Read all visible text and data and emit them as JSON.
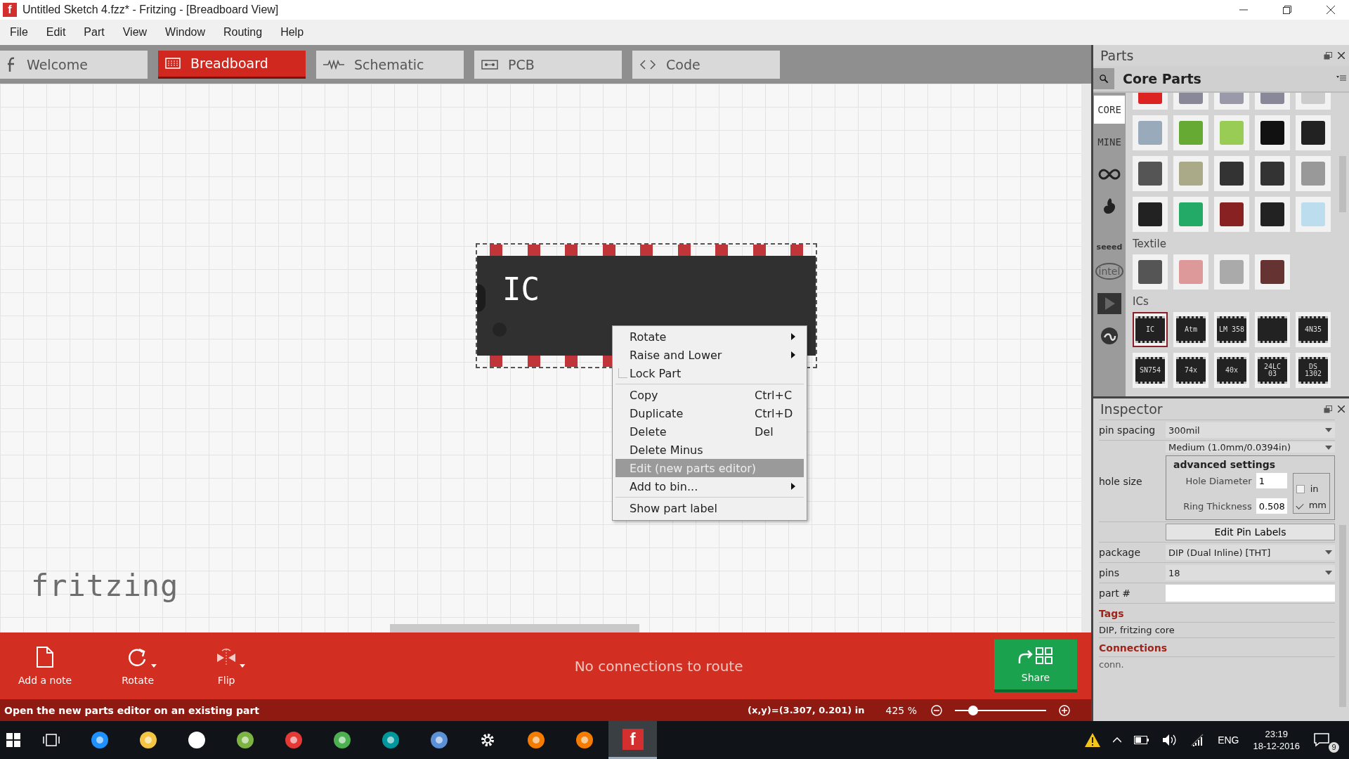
{
  "window": {
    "app_glyph": "f",
    "title": "Untitled Sketch 4.fzz* - Fritzing - [Breadboard View]"
  },
  "menu": [
    "File",
    "Edit",
    "Part",
    "View",
    "Window",
    "Routing",
    "Help"
  ],
  "tabs": [
    {
      "kind": "welcome",
      "label": "Welcome",
      "selected": false
    },
    {
      "kind": "breadboard",
      "label": "Breadboard",
      "selected": true
    },
    {
      "kind": "schematic",
      "label": "Schematic",
      "selected": false
    },
    {
      "kind": "pcb",
      "label": "PCB",
      "selected": false
    },
    {
      "kind": "code",
      "label": "Code",
      "selected": false
    }
  ],
  "canvas": {
    "part_label": "IC",
    "logo": "fritzing"
  },
  "context_menu": [
    {
      "kind": "submenu",
      "label": "Rotate",
      "selected": false
    },
    {
      "kind": "submenu",
      "label": "Raise and Lower",
      "selected": false
    },
    {
      "kind": "check",
      "label": "Lock Part",
      "checked": false,
      "selected": false
    },
    {
      "kind": "separator"
    },
    {
      "kind": "action",
      "label": "Copy",
      "shortcut": "Ctrl+C",
      "selected": false
    },
    {
      "kind": "action",
      "label": "Duplicate",
      "shortcut": "Ctrl+D",
      "selected": false
    },
    {
      "kind": "action",
      "label": "Delete",
      "shortcut": "Del",
      "selected": false
    },
    {
      "kind": "action",
      "label": "Delete Minus",
      "selected": false
    },
    {
      "kind": "action",
      "label": "Edit (new parts editor)",
      "selected": true
    },
    {
      "kind": "submenu",
      "label": "Add to bin...",
      "selected": false
    },
    {
      "kind": "separator"
    },
    {
      "kind": "action",
      "label": "Show part label",
      "selected": false
    }
  ],
  "toolbar": {
    "tools": [
      {
        "kind": "note",
        "label": "Add a note",
        "caret": false
      },
      {
        "kind": "rotate",
        "label": "Rotate",
        "caret": true
      },
      {
        "kind": "flip",
        "label": "Flip",
        "caret": true
      }
    ],
    "routing_status": "No connections to route",
    "share": "Share"
  },
  "status_bar": {
    "message": "Open the new parts editor on an existing part",
    "coordinates": "(x,y)=(3.307, 0.201) in",
    "zoom": "425 %",
    "zoom_slider": {
      "level": 0.2
    }
  },
  "parts": {
    "title": "Parts",
    "bin_title": "Core Parts",
    "bins": [
      {
        "kind": "text",
        "label": "CORE",
        "selected": true
      },
      {
        "kind": "text",
        "label": "MINE",
        "selected": false
      },
      {
        "kind": "infinity",
        "selected": false
      },
      {
        "kind": "flame",
        "selected": false
      },
      {
        "kind": "seeed",
        "label": "seeed",
        "selected": false
      },
      {
        "kind": "intel",
        "label": "intel",
        "selected": false
      },
      {
        "kind": "play",
        "selected": false
      },
      {
        "kind": "swirl",
        "selected": false
      }
    ],
    "sections": [
      {
        "tiles": [
          {
            "kind": "led",
            "selected": false
          },
          {
            "kind": "sensor",
            "selected": false
          },
          {
            "kind": "button",
            "selected": false
          },
          {
            "kind": "sensor",
            "selected": false
          },
          {
            "kind": "switch",
            "selected": false
          },
          {
            "kind": "matrix",
            "selected": false
          },
          {
            "kind": "lcd",
            "selected": false
          },
          {
            "kind": "display",
            "selected": false
          },
          {
            "kind": "buzzer",
            "selected": false
          },
          {
            "kind": "speaker",
            "selected": false
          },
          {
            "kind": "piezo",
            "selected": false
          },
          {
            "kind": "motor",
            "selected": false
          },
          {
            "kind": "driver",
            "selected": false
          },
          {
            "kind": "servo",
            "selected": false
          },
          {
            "kind": "stepper",
            "selected": false
          },
          {
            "kind": "battery",
            "selected": false
          },
          {
            "kind": "board",
            "selected": false
          },
          {
            "kind": "module",
            "selected": false
          },
          {
            "kind": "relay",
            "selected": false
          },
          {
            "kind": "lamp",
            "selected": false
          }
        ]
      },
      {
        "title": "Textile",
        "tiles": [
          {
            "kind": "fabric",
            "selected": false
          },
          {
            "kind": "thread",
            "selected": false
          },
          {
            "kind": "patch",
            "selected": false
          },
          {
            "kind": "wire",
            "selected": false
          }
        ]
      },
      {
        "title": "ICs",
        "tiles": [
          {
            "kind": "ic",
            "label": "IC",
            "selected": true
          },
          {
            "kind": "ic",
            "label": "Atm",
            "selected": false
          },
          {
            "kind": "ic",
            "label": "LM 358",
            "selected": false
          },
          {
            "kind": "ic",
            "selected": false
          },
          {
            "kind": "ic",
            "label": "4N35",
            "selected": false
          },
          {
            "kind": "ic",
            "label": "SN754",
            "selected": false
          },
          {
            "kind": "ic",
            "label": "74x",
            "selected": false
          },
          {
            "kind": "ic",
            "label": "40x",
            "selected": false
          },
          {
            "kind": "ic",
            "label": "24LC 03",
            "selected": false
          },
          {
            "kind": "ic",
            "label": "DS 1302",
            "selected": false
          }
        ]
      }
    ]
  },
  "inspector": {
    "title": "Inspector",
    "pin_spacing": {
      "label": "pin spacing",
      "value": "300mil"
    },
    "hole_size": {
      "label": "hole size",
      "value": "Medium (1.0mm/0.0394in)",
      "group_title": "advanced settings",
      "fields": [
        {
          "label": "Hole Diameter",
          "value": "1"
        },
        {
          "label": "Ring Thickness",
          "value": "0.508"
        }
      ],
      "units": [
        {
          "label": "in",
          "checked": false
        },
        {
          "label": "mm",
          "checked": true
        }
      ]
    },
    "edit_pin_labels": "Edit Pin Labels",
    "package": {
      "label": "package",
      "value": "DIP (Dual Inline) [THT]"
    },
    "pins": {
      "label": "pins",
      "value": "18"
    },
    "part_number": {
      "label": "part #"
    },
    "tags_title": "Tags",
    "tags": "DIP, fritzing core",
    "connections_title": "Connections",
    "connections": "conn."
  },
  "taskbar": {
    "apps": [
      {
        "kind": "taskview",
        "selected": false
      },
      {
        "kind": "edge",
        "selected": false
      },
      {
        "kind": "explorer",
        "selected": false
      },
      {
        "kind": "store",
        "selected": false
      },
      {
        "kind": "evernote",
        "selected": false
      },
      {
        "kind": "chrome",
        "selected": false
      },
      {
        "kind": "tripadvisor",
        "selected": false
      },
      {
        "kind": "arduino",
        "selected": false
      },
      {
        "kind": "app",
        "selected": false
      },
      {
        "kind": "settings",
        "selected": false
      },
      {
        "kind": "firefox",
        "selected": false
      },
      {
        "kind": "firefox",
        "selected": false
      },
      {
        "kind": "fritzing",
        "glyph": "f",
        "selected": true
      }
    ],
    "language": "ENG",
    "time": "23:19",
    "date": "18-12-2016",
    "notifications": "9"
  }
}
